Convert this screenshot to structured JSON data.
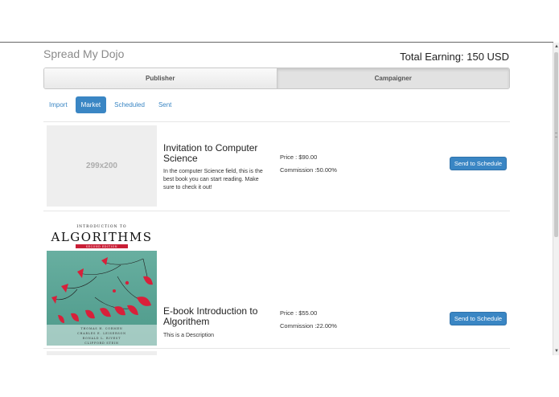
{
  "header": {
    "brand": "Spread My Dojo",
    "total_earning": "Total Earning: 150 USD"
  },
  "role_tabs": [
    {
      "label": "Publisher",
      "active": false
    },
    {
      "label": "Campaigner",
      "active": true
    }
  ],
  "pills": [
    {
      "label": "Import",
      "active": false
    },
    {
      "label": "Market",
      "active": true
    },
    {
      "label": "Scheduled",
      "active": false
    },
    {
      "label": "Sent",
      "active": false
    }
  ],
  "items": [
    {
      "thumb_placeholder": "299x200",
      "title": "Invitation to Computer Science",
      "description": "In the computer Science field, this is the best book you can start reading. Make sure to check it out!",
      "price": "Price : $90.00",
      "commission": "Commission :50.00%",
      "action": "Send to Schedule"
    },
    {
      "cover": {
        "top_text": "INTRODUCTION TO",
        "title": "ALGORITHMS",
        "edition": "SECOND EDITION",
        "authors": [
          "THOMAS H. CORMEN",
          "CHARLES E. LEISERSON",
          "RONALD L. RIVEST",
          "CLIFFORD STEIN"
        ]
      },
      "title": "E-book Introduction to Algorithem",
      "description": "This is a Description",
      "price": "Price : $55.00",
      "commission": "Commission :22.00%",
      "action": "Send to Schedule"
    }
  ],
  "colors": {
    "accent": "#3a86c4",
    "placeholder_bg": "#eeeeee",
    "cover_bg": "#5ea898",
    "cover_red": "#d8203a"
  }
}
